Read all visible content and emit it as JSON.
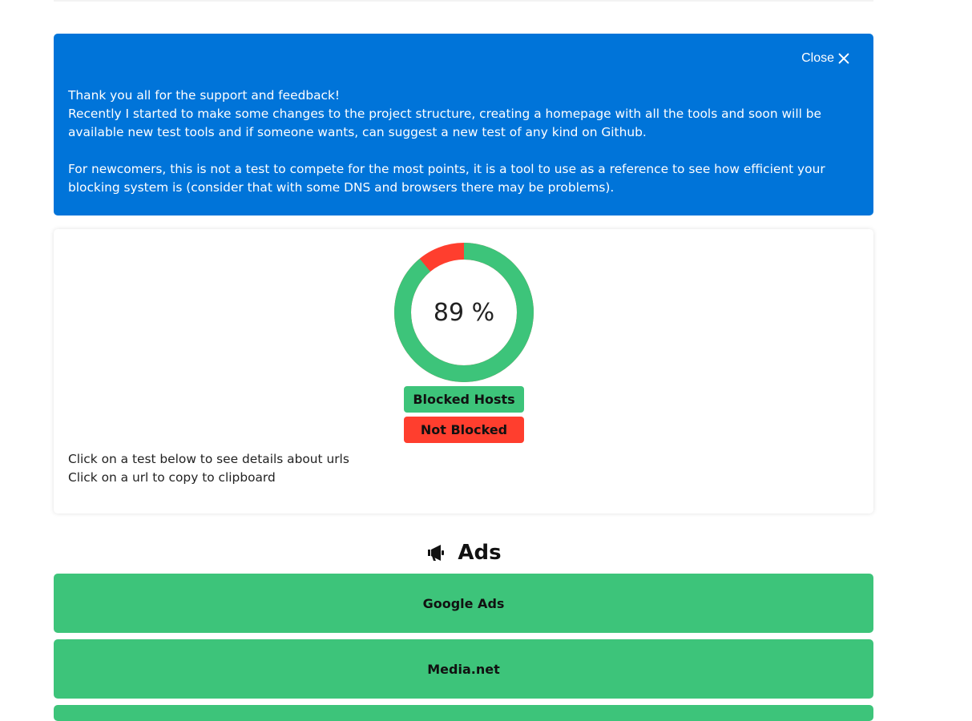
{
  "notice": {
    "close_label": "Close",
    "line1": "Thank you all for the support and feedback!",
    "line2": "Recently I started to make some changes to the project structure, creating a homepage with all the tools and soon will be available new test tools and if someone wants, can suggest a new test of any kind on Github.",
    "line3": "For newcomers, this is not a test to compete for the most points, it is a tool to use as a reference to see how efficient your blocking system is (consider that with some DNS and browsers there may be problems).",
    "background_color": "#0074d9"
  },
  "score": {
    "percent_label": "89 %",
    "blocked_fraction": 0.89,
    "blocked_color": "#3dc47a",
    "not_blocked_color": "#ff3e2e"
  },
  "legend": {
    "blocked_label": "Blocked Hosts",
    "not_blocked_label": "Not Blocked"
  },
  "hints": {
    "line1": "Click on a test below to see details about urls",
    "line2": "Click on a url to copy to clipboard"
  },
  "section": {
    "title": "Ads",
    "icon": "megaphone-icon",
    "tests": [
      {
        "label": "Google Ads",
        "status": "blocked"
      },
      {
        "label": "Media.net",
        "status": "blocked"
      },
      {
        "label": "",
        "status": "blocked"
      }
    ]
  }
}
